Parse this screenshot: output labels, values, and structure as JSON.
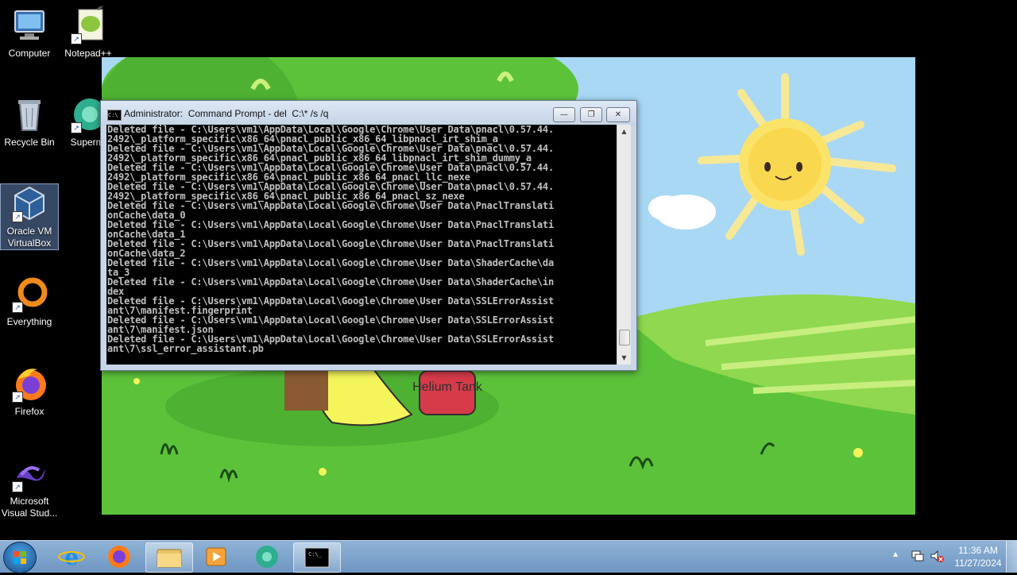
{
  "desktop_icons": [
    {
      "label": "Computer",
      "icon": "computer-icon"
    },
    {
      "label": "Notepad++",
      "icon": "notepadpp-icon"
    },
    {
      "label": "Recycle Bin",
      "icon": "recycle-bin-icon"
    },
    {
      "label": "Supermi",
      "icon": "supermium-icon"
    },
    {
      "label": "Oracle VM VirtualBox",
      "icon": "virtualbox-icon"
    },
    {
      "label": "Everything",
      "icon": "everything-icon"
    },
    {
      "label": "Firefox",
      "icon": "firefox-icon"
    },
    {
      "label": "Microsoft Visual Stud...",
      "icon": "visual-studio-icon"
    }
  ],
  "wallpaper": {
    "sign_text": "Helium Tank",
    "sky_color": "#a9d8f5",
    "grass_color": "#5cc23a"
  },
  "cmd_window": {
    "title": "Administrator:  Command Prompt - del  C:\\* /s /q",
    "minimize_symbol": "—",
    "maximize_symbol": "❐",
    "close_symbol": "✕",
    "scroll_up": "▲",
    "scroll_down": "▼",
    "lines": [
      "Deleted file - C:\\Users\\vm1\\AppData\\Local\\Google\\Chrome\\User Data\\pnacl\\0.57.44.",
      "2492\\_platform_specific\\x86_64\\pnacl_public_x86_64_libpnacl_irt_shim_a",
      "Deleted file - C:\\Users\\vm1\\AppData\\Local\\Google\\Chrome\\User Data\\pnacl\\0.57.44.",
      "2492\\_platform_specific\\x86_64\\pnacl_public_x86_64_libpnacl_irt_shim_dummy_a",
      "Deleted file - C:\\Users\\vm1\\AppData\\Local\\Google\\Chrome\\User Data\\pnacl\\0.57.44.",
      "2492\\_platform_specific\\x86_64\\pnacl_public_x86_64_pnacl_llc_nexe",
      "Deleted file - C:\\Users\\vm1\\AppData\\Local\\Google\\Chrome\\User Data\\pnacl\\0.57.44.",
      "2492\\_platform_specific\\x86_64\\pnacl_public_x86_64_pnacl_sz_nexe",
      "Deleted file - C:\\Users\\vm1\\AppData\\Local\\Google\\Chrome\\User Data\\PnaclTranslati",
      "onCache\\data_0",
      "Deleted file - C:\\Users\\vm1\\AppData\\Local\\Google\\Chrome\\User Data\\PnaclTranslati",
      "onCache\\data_1",
      "Deleted file - C:\\Users\\vm1\\AppData\\Local\\Google\\Chrome\\User Data\\PnaclTranslati",
      "onCache\\data_2",
      "Deleted file - C:\\Users\\vm1\\AppData\\Local\\Google\\Chrome\\User Data\\ShaderCache\\da",
      "ta_3",
      "Deleted file - C:\\Users\\vm1\\AppData\\Local\\Google\\Chrome\\User Data\\ShaderCache\\in",
      "dex",
      "Deleted file - C:\\Users\\vm1\\AppData\\Local\\Google\\Chrome\\User Data\\SSLErrorAssist",
      "ant\\7\\manifest.fingerprint",
      "Deleted file - C:\\Users\\vm1\\AppData\\Local\\Google\\Chrome\\User Data\\SSLErrorAssist",
      "ant\\7\\manifest.json",
      "Deleted file - C:\\Users\\vm1\\AppData\\Local\\Google\\Chrome\\User Data\\SSLErrorAssist",
      "ant\\7\\ssl_error_assistant.pb"
    ]
  },
  "taskbar": {
    "pinned": [
      "internet-explorer-icon",
      "firefox-icon",
      "file-explorer-icon",
      "media-player-icon",
      "supermium-icon",
      "command-prompt-icon"
    ],
    "clock_time": "11:36 AM",
    "clock_date": "11/27/2024",
    "tray_chevron": "▲"
  }
}
